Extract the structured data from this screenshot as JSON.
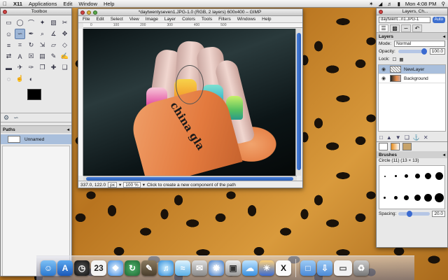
{
  "menubar": {
    "apple": "",
    "app": "X11",
    "items": [
      "Applications",
      "Edit",
      "Window",
      "Help"
    ],
    "clock": "Mon 4:08 PM"
  },
  "toolbox": {
    "title": "Toolbox",
    "tools": [
      "rect-select",
      "ellipse-select",
      "free-select",
      "fuzzy-select",
      "color-select",
      "scissors",
      "foreground-select",
      "paths",
      "color-picker",
      "zoom",
      "measure",
      "move",
      "align",
      "crop",
      "rotate",
      "scale",
      "shear",
      "perspective",
      "flip",
      "text",
      "bucket-fill",
      "blend",
      "pencil",
      "paintbrush",
      "eraser",
      "airbrush",
      "ink",
      "clone",
      "heal",
      "perspective-clone",
      "blur",
      "smudge",
      "dodge"
    ],
    "paths_panel_title": "Paths",
    "path_name": "Unnamed"
  },
  "image_window": {
    "title": "*daytwentyseven1.JPG-1.0 (RGB, 2 layers) 600x400 – GIMP",
    "menu": [
      "File",
      "Edit",
      "Select",
      "View",
      "Image",
      "Layer",
      "Colors",
      "Tools",
      "Filters",
      "Windows",
      "Help"
    ],
    "ruler_ticks": [
      "0",
      "100",
      "200",
      "300",
      "400",
      "500"
    ],
    "bottle_text": "china gla",
    "status": {
      "coords": "337.0, 122.0",
      "unit": "px",
      "zoom": "100 %",
      "message": "Click to create a new component of the path"
    }
  },
  "layers_window": {
    "title": "Layers, Ch...",
    "image_select": "daytwent...n1.JPG-1",
    "auto_label": "Auto",
    "dock_title": "Layers",
    "mode_label": "Mode:",
    "mode_value": "Normal",
    "opacity_label": "Opacity:",
    "opacity_value": "100.0",
    "lock_label": "Lock:",
    "layers": [
      {
        "name": "NewLayer",
        "selected": true
      },
      {
        "name": "Background",
        "selected": false
      }
    ],
    "brushes_title": "Brushes",
    "brush_name": "Circle (11) (13 × 13)",
    "spacing_label": "Spacing:",
    "spacing_value": "20.0"
  },
  "dock": {
    "icons": [
      "finder-icon",
      "app-store-icon",
      "dashboard-icon",
      "calendar-icon",
      "safari-icon",
      "time-machine-icon",
      "gimp-icon",
      "itunes-icon",
      "tune-icon",
      "mail-icon",
      "photo-booth-icon",
      "preview-icon",
      "icloud-icon",
      "iphoto-icon",
      "x11-icon",
      "folder-icon",
      "downloads-icon",
      "window-thumb-icon",
      "trash-icon"
    ],
    "calendar_day": "23",
    "x11_glyph": "X"
  }
}
